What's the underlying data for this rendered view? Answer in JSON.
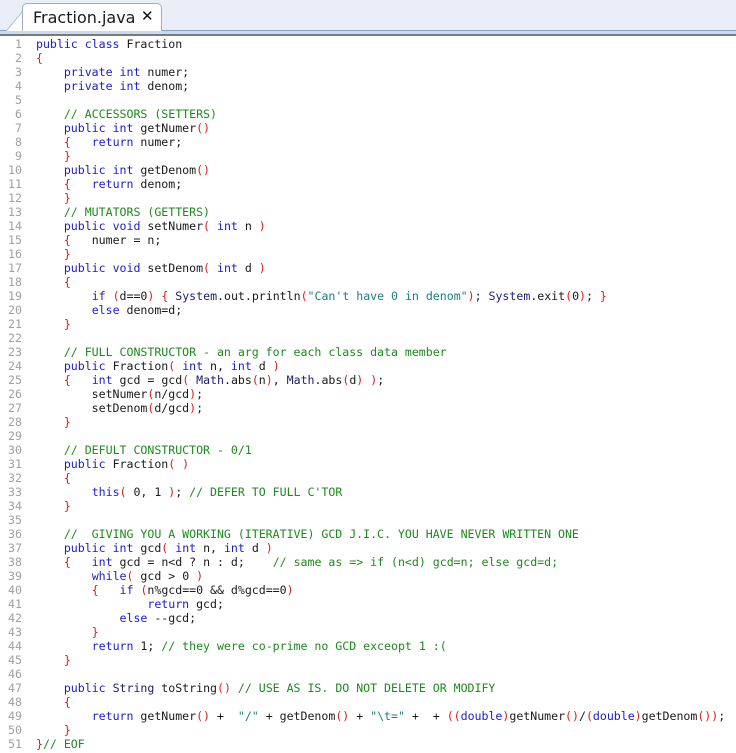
{
  "tab": {
    "label": "Fraction.java",
    "close_icon": "close-icon"
  },
  "colors": {
    "keyword": "#1b1bd2",
    "comment": "#1c8a1c",
    "string": "#1a8080",
    "paren": "#e01b1b",
    "line_number": "#a0a0a0",
    "tabbar_bg": "#eaeef9"
  },
  "lines": [
    [
      [
        "k",
        "public class"
      ],
      [
        "",
        "Fraction"
      ]
    ],
    [
      [
        "p",
        "{"
      ]
    ],
    [
      [
        "",
        "    "
      ],
      [
        "k",
        "private int"
      ],
      [
        "",
        "numer;"
      ]
    ],
    [
      [
        "",
        "    "
      ],
      [
        "k",
        "private int"
      ],
      [
        "",
        "denom;"
      ]
    ],
    [],
    [
      [
        "",
        "    "
      ],
      [
        "c",
        "// ACCESSORS (SETTERS)"
      ]
    ],
    [
      [
        "",
        "    "
      ],
      [
        "k",
        "public int"
      ],
      [
        "",
        "getNumer"
      ],
      [
        "p",
        "()"
      ]
    ],
    [
      [
        "",
        "    "
      ],
      [
        "p",
        "{"
      ],
      [
        "",
        "   "
      ],
      [
        "k",
        "return"
      ],
      [
        "",
        "numer;"
      ]
    ],
    [
      [
        "",
        "    "
      ],
      [
        "p",
        "}"
      ]
    ],
    [
      [
        "",
        "    "
      ],
      [
        "k",
        "public int"
      ],
      [
        "",
        "getDenom"
      ],
      [
        "p",
        "()"
      ]
    ],
    [
      [
        "",
        "    "
      ],
      [
        "p",
        "{"
      ],
      [
        "",
        "   "
      ],
      [
        "k",
        "return"
      ],
      [
        "",
        "denom;"
      ]
    ],
    [
      [
        "",
        "    "
      ],
      [
        "p",
        "}"
      ]
    ],
    [
      [
        "",
        "    "
      ],
      [
        "c",
        "// MUTATORS (GETTERS)"
      ]
    ],
    [
      [
        "",
        "    "
      ],
      [
        "k",
        "public void"
      ],
      [
        "",
        "setNumer"
      ],
      [
        "p",
        "("
      ],
      [
        "",
        " "
      ],
      [
        "k",
        "int"
      ],
      [
        "",
        " n "
      ],
      [
        "p",
        ")"
      ]
    ],
    [
      [
        "",
        "    "
      ],
      [
        "p",
        "{"
      ],
      [
        "",
        "   numer = n;"
      ]
    ],
    [
      [
        "",
        "    "
      ],
      [
        "p",
        "}"
      ]
    ],
    [
      [
        "",
        "    "
      ],
      [
        "k",
        "public void"
      ],
      [
        "",
        "setDenom"
      ],
      [
        "p",
        "("
      ],
      [
        "",
        " "
      ],
      [
        "k",
        "int"
      ],
      [
        "",
        " d "
      ],
      [
        "p",
        ")"
      ]
    ],
    [
      [
        "",
        "    "
      ],
      [
        "p",
        "{"
      ]
    ],
    [
      [
        "",
        "        "
      ],
      [
        "k",
        "if"
      ],
      [
        "",
        " "
      ],
      [
        "p",
        "("
      ],
      [
        "",
        "d==0"
      ],
      [
        "p",
        ")"
      ],
      [
        "",
        " "
      ],
      [
        "p",
        "{"
      ],
      [
        "",
        " "
      ],
      [
        "t",
        "System"
      ],
      [
        "",
        ".out.println"
      ],
      [
        "p",
        "("
      ],
      [
        "s",
        "\"Can't have 0 in denom\""
      ],
      [
        "p",
        ")"
      ],
      [
        "",
        "; "
      ],
      [
        "t",
        "System"
      ],
      [
        "",
        ".exit"
      ],
      [
        "p",
        "("
      ],
      [
        "",
        "0"
      ],
      [
        "p",
        ")"
      ],
      [
        "",
        "; "
      ],
      [
        "p",
        "}"
      ]
    ],
    [
      [
        "",
        "        "
      ],
      [
        "k",
        "else"
      ],
      [
        "",
        " denom=d;"
      ]
    ],
    [
      [
        "",
        "    "
      ],
      [
        "p",
        "}"
      ]
    ],
    [],
    [
      [
        "",
        "    "
      ],
      [
        "c",
        "// FULL CONSTRUCTOR - an arg for each class data member"
      ]
    ],
    [
      [
        "",
        "    "
      ],
      [
        "k",
        "public"
      ],
      [
        "",
        " Fraction"
      ],
      [
        "p",
        "("
      ],
      [
        "",
        " "
      ],
      [
        "k",
        "int"
      ],
      [
        "",
        " n, "
      ],
      [
        "k",
        "int"
      ],
      [
        "",
        " d "
      ],
      [
        "p",
        ")"
      ]
    ],
    [
      [
        "",
        "    "
      ],
      [
        "p",
        "{"
      ],
      [
        "",
        "   "
      ],
      [
        "k",
        "int"
      ],
      [
        "",
        " gcd = gcd"
      ],
      [
        "p",
        "("
      ],
      [
        "",
        " "
      ],
      [
        "t",
        "Math"
      ],
      [
        "",
        ".abs"
      ],
      [
        "p",
        "("
      ],
      [
        "",
        "n"
      ],
      [
        "p",
        ")"
      ],
      [
        "",
        ", "
      ],
      [
        "t",
        "Math"
      ],
      [
        "",
        ".abs"
      ],
      [
        "p",
        "("
      ],
      [
        "",
        "d"
      ],
      [
        "p",
        ")"
      ],
      [
        "",
        " "
      ],
      [
        "p",
        ")"
      ],
      [
        "",
        ";"
      ]
    ],
    [
      [
        "",
        "        setNumer"
      ],
      [
        "p",
        "("
      ],
      [
        "",
        "n/gcd"
      ],
      [
        "p",
        ")"
      ],
      [
        "",
        ";"
      ]
    ],
    [
      [
        "",
        "        setDenom"
      ],
      [
        "p",
        "("
      ],
      [
        "",
        "d/gcd"
      ],
      [
        "p",
        ")"
      ],
      [
        "",
        ";"
      ]
    ],
    [
      [
        "",
        "    "
      ],
      [
        "p",
        "}"
      ]
    ],
    [],
    [
      [
        "",
        "    "
      ],
      [
        "c",
        "// DEFULT CONSTRUCTOR - 0/1"
      ]
    ],
    [
      [
        "",
        "    "
      ],
      [
        "k",
        "public"
      ],
      [
        "",
        " Fraction"
      ],
      [
        "p",
        "( )"
      ]
    ],
    [
      [
        "",
        "    "
      ],
      [
        "p",
        "{"
      ]
    ],
    [
      [
        "",
        "        "
      ],
      [
        "k",
        "this"
      ],
      [
        "p",
        "("
      ],
      [
        "",
        " 0, 1 "
      ],
      [
        "p",
        ")"
      ],
      [
        "",
        "; "
      ],
      [
        "c",
        "// DEFER TO FULL C'TOR"
      ]
    ],
    [
      [
        "",
        "    "
      ],
      [
        "p",
        "}"
      ]
    ],
    [],
    [
      [
        "",
        "    "
      ],
      [
        "c",
        "//  GIVING YOU A WORKING (ITERATIVE) GCD J.I.C. YOU HAVE NEVER WRITTEN ONE"
      ]
    ],
    [
      [
        "",
        "    "
      ],
      [
        "k",
        "public int"
      ],
      [
        "",
        " gcd"
      ],
      [
        "p",
        "("
      ],
      [
        "",
        " "
      ],
      [
        "k",
        "int"
      ],
      [
        "",
        " n, "
      ],
      [
        "k",
        "int"
      ],
      [
        "",
        " d "
      ],
      [
        "p",
        ")"
      ]
    ],
    [
      [
        "",
        "    "
      ],
      [
        "p",
        "{"
      ],
      [
        "",
        "   "
      ],
      [
        "k",
        "int"
      ],
      [
        "",
        " gcd = n<d ? n : d;    "
      ],
      [
        "c",
        "// same as => if (n<d) gcd=n; else gcd=d;"
      ]
    ],
    [
      [
        "",
        "        "
      ],
      [
        "k",
        "while"
      ],
      [
        "p",
        "("
      ],
      [
        "",
        " gcd > 0 "
      ],
      [
        "p",
        ")"
      ]
    ],
    [
      [
        "",
        "        "
      ],
      [
        "p",
        "{"
      ],
      [
        "",
        "   "
      ],
      [
        "k",
        "if"
      ],
      [
        "",
        " "
      ],
      [
        "p",
        "("
      ],
      [
        "",
        "n%gcd==0 && d%gcd==0"
      ],
      [
        "p",
        ")"
      ]
    ],
    [
      [
        "",
        "                "
      ],
      [
        "k",
        "return"
      ],
      [
        "",
        " gcd;"
      ]
    ],
    [
      [
        "",
        "            "
      ],
      [
        "k",
        "else"
      ],
      [
        "",
        " --gcd;"
      ]
    ],
    [
      [
        "",
        "        "
      ],
      [
        "p",
        "}"
      ]
    ],
    [
      [
        "",
        "        "
      ],
      [
        "k",
        "return"
      ],
      [
        "",
        " 1; "
      ],
      [
        "c",
        "// they were co-prime no GCD exceopt 1 :("
      ]
    ],
    [
      [
        "",
        "    "
      ],
      [
        "p",
        "}"
      ]
    ],
    [],
    [
      [
        "",
        "    "
      ],
      [
        "k",
        "public"
      ],
      [
        "",
        " "
      ],
      [
        "t",
        "String"
      ],
      [
        "",
        " toString"
      ],
      [
        "p",
        "()"
      ],
      [
        "",
        " "
      ],
      [
        "c",
        "// USE AS IS. DO NOT DELETE OR MODIFY"
      ]
    ],
    [
      [
        "",
        "    "
      ],
      [
        "p",
        "{"
      ]
    ],
    [
      [
        "",
        "        "
      ],
      [
        "k",
        "return"
      ],
      [
        "",
        " getNumer"
      ],
      [
        "p",
        "()"
      ],
      [
        "",
        " +  "
      ],
      [
        "s",
        "\"/\""
      ],
      [
        "",
        " + getDenom"
      ],
      [
        "p",
        "()"
      ],
      [
        "",
        " + "
      ],
      [
        "s",
        "\"\\t=\""
      ],
      [
        "",
        " +  + "
      ],
      [
        "p",
        "(("
      ],
      [
        "k",
        "double"
      ],
      [
        "p",
        ")"
      ],
      [
        "",
        "getNumer"
      ],
      [
        "p",
        "()"
      ],
      [
        "",
        "/"
      ],
      [
        "p",
        "("
      ],
      [
        "k",
        "double"
      ],
      [
        "p",
        ")"
      ],
      [
        "",
        "getDenom"
      ],
      [
        "p",
        "())"
      ],
      [
        "",
        ";"
      ]
    ],
    [
      [
        "",
        "    "
      ],
      [
        "p",
        "}"
      ]
    ],
    [
      [
        "p",
        "}"
      ],
      [
        "c",
        "// EOF"
      ]
    ]
  ]
}
